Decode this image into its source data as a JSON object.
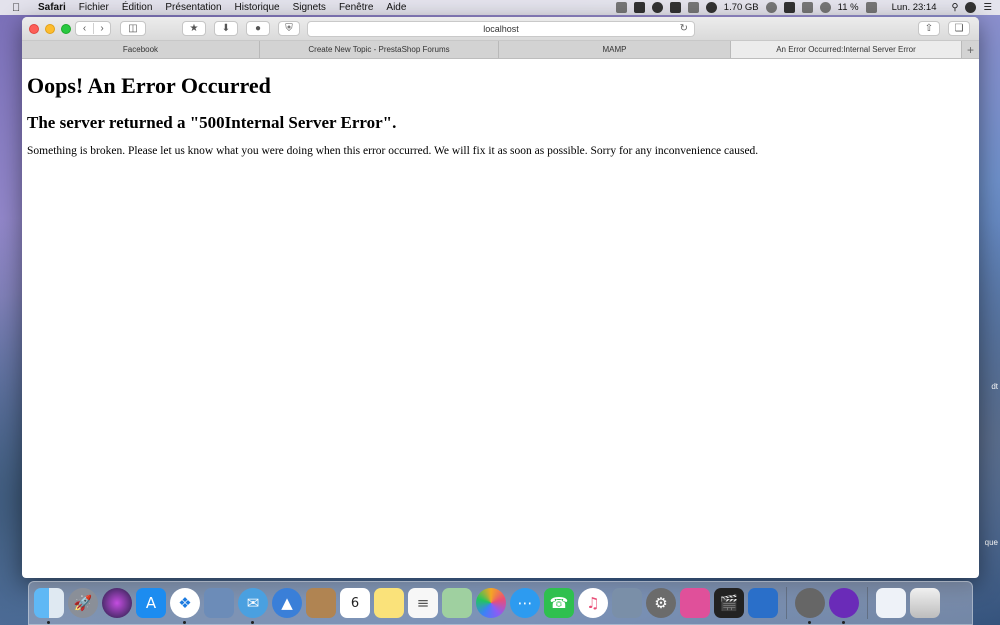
{
  "menubar": {
    "app": "Safari",
    "items": [
      "Fichier",
      "Édition",
      "Présentation",
      "Historique",
      "Signets",
      "Fenêtre",
      "Aide"
    ],
    "memory": "1.70 GB",
    "battery": "11 %",
    "clock": "Lun. 23:14"
  },
  "browser": {
    "address": "localhost",
    "tabs": [
      {
        "label": "Facebook"
      },
      {
        "label": "Create New Topic - PrestaShop Forums"
      },
      {
        "label": "MAMP"
      },
      {
        "label": "An Error Occurred:Internal Server Error"
      }
    ],
    "new_tab": "+"
  },
  "page": {
    "heading": "Oops! An Error Occurred",
    "subheading": "The server returned a \"500Internal Server Error\".",
    "message": "Something is broken. Please let us know what you were doing when this error occurred. We will fix it as soon as possible. Sorry for any inconvenience caused."
  },
  "desktop": {
    "label_1": "dt",
    "label_2": "que"
  },
  "dock": {
    "calendar_day": "6"
  }
}
